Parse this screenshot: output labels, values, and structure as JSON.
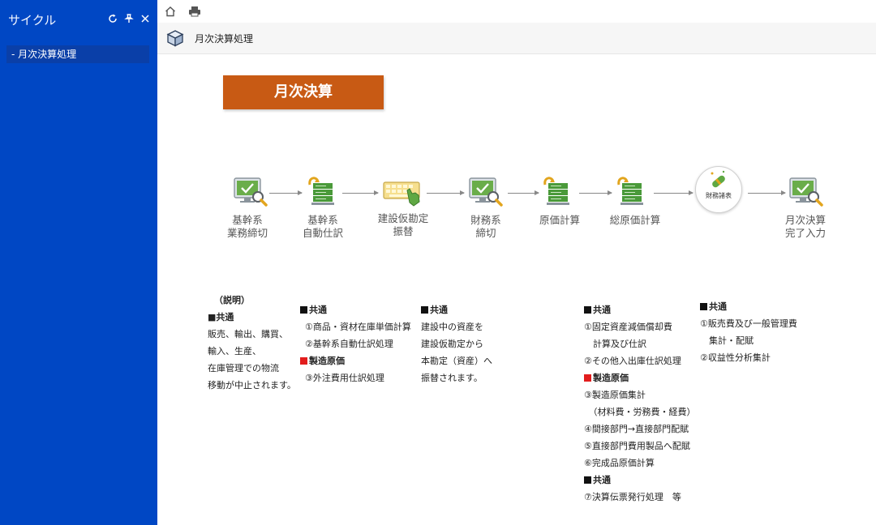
{
  "sidebar": {
    "title": "サイクル",
    "item": "- 月次決算処理"
  },
  "page": {
    "title": "月次決算処理"
  },
  "banner": "月次決算",
  "flow": {
    "steps": [
      {
        "label": "基幹系\n業務締切",
        "icon": "monitor-check-icon"
      },
      {
        "label": "基幹系\n自動仕訳",
        "icon": "server-cycle-icon"
      },
      {
        "label": "建設仮勘定\n振替",
        "icon": "keyboard-hand-icon"
      },
      {
        "label": "財務系\n締切",
        "icon": "monitor-check-icon"
      },
      {
        "label": "原価計算",
        "icon": "server-cycle-icon"
      },
      {
        "label": "総原価計算",
        "icon": "server-cycle-icon"
      },
      {
        "label": "",
        "icon": "report-icon",
        "inner_label": "財務諸表"
      },
      {
        "label": "月次決算\n完了入力",
        "icon": "monitor-check-icon"
      }
    ]
  },
  "notes": {
    "col1": {
      "title": "（説明）",
      "heading": "■共通",
      "lines": [
        "販売、輸出、購買、",
        "輸入、生産、",
        "在庫管理での物流",
        "移動が中止されます。"
      ]
    },
    "col2": {
      "heading1": "共通",
      "lines1": [
        "①商品・資材在庫単価計算",
        "②基幹系自動仕訳処理"
      ],
      "heading2": "製造原価",
      "lines2": [
        "③外注費用仕訳処理"
      ]
    },
    "col3": {
      "heading": "共通",
      "lines": [
        "建設中の資産を",
        "建設仮勘定から",
        "本勘定（資産）へ",
        "振替されます。"
      ]
    },
    "col4": {
      "heading1": "共通",
      "lines1": [
        "①固定資産減価償却費",
        "　計算及び仕訳",
        "②その他入出庫仕訳処理"
      ],
      "heading2": "製造原価",
      "lines2": [
        "③製造原価集計",
        "　（材料費・労務費・経費）",
        "④間接部門→直接部門配賦",
        "⑤直接部門費用製品へ配賦",
        "⑥完成品原価計算"
      ],
      "heading3": "共通",
      "lines3": [
        "⑦決算伝票発行処理　等"
      ]
    },
    "col5": {
      "heading": "共通",
      "lines": [
        "①販売費及び一般管理費",
        "　集計・配賦",
        "②収益性分析集計"
      ]
    }
  },
  "colors": {
    "sidebar": "#0047c4",
    "banner": "#c85a14",
    "icon_green": "#4a9a3a",
    "red_marker": "#e21d1d"
  }
}
